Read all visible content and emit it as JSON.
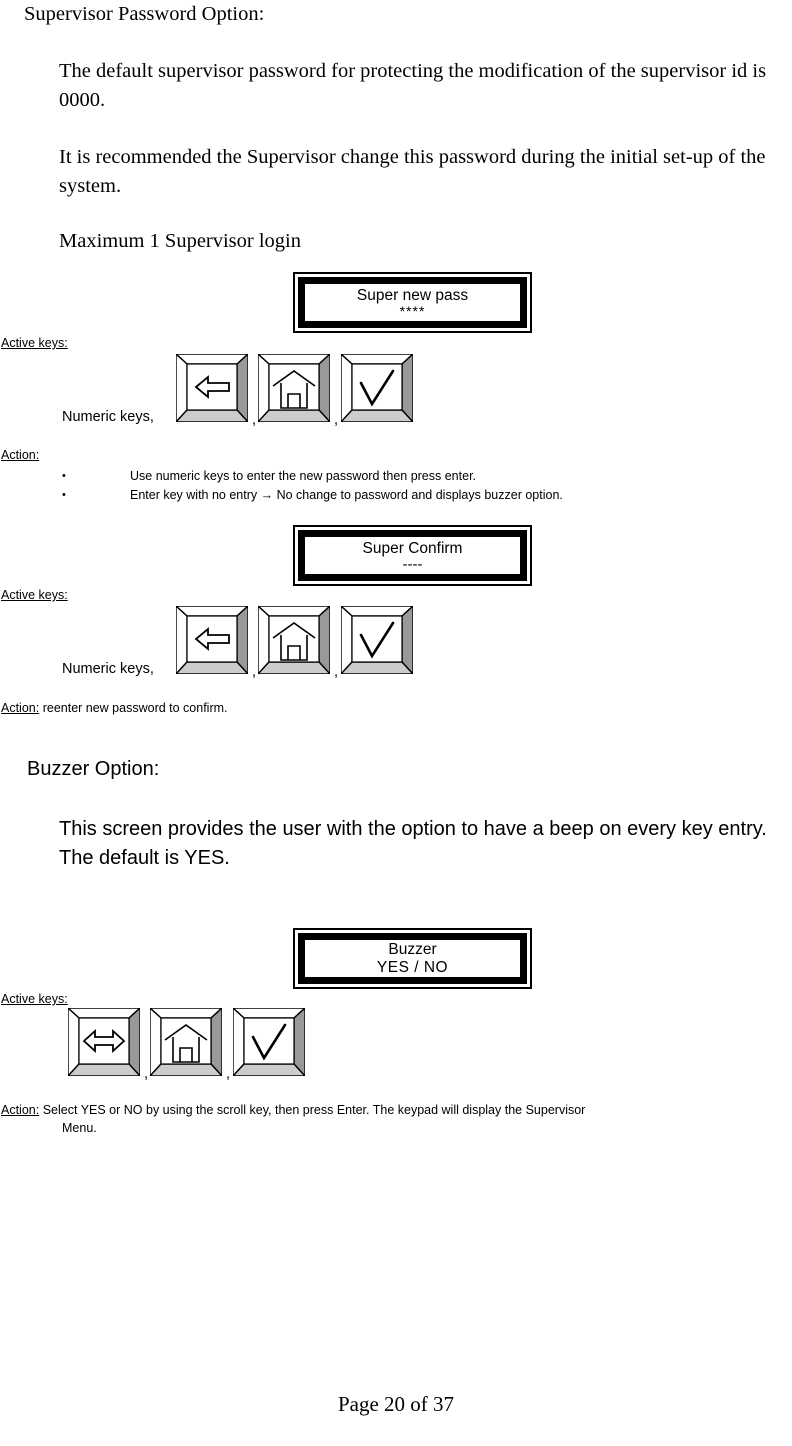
{
  "document": {
    "page_footer": "Page 20 of 37"
  },
  "section_supervisor": {
    "heading": "Supervisor Password Option:",
    "paragraph_1": "The default supervisor password for protecting the modification of the supervisor id is 0000.",
    "paragraph_2": "It is recommended the Supervisor change this password during the initial set-up of the system.",
    "paragraph_3": "Maximum 1 Supervisor login"
  },
  "screen_new_pass": {
    "line1": "Super new pass",
    "line2": "****"
  },
  "active_keys_1": {
    "label": "Active keys:",
    "numeric_label": "Numeric keys,",
    "separator": ",",
    "keys": [
      {
        "name": "back-arrow-key",
        "glyph": "left-arrow-icon"
      },
      {
        "name": "home-key",
        "glyph": "house-icon"
      },
      {
        "name": "enter-key",
        "glyph": "checkmark-icon"
      }
    ]
  },
  "action_1": {
    "label": "Action:",
    "bullets": [
      "Use numeric keys to enter the new password then press enter.",
      "Enter key with no entry → No change to password and displays buzzer option."
    ]
  },
  "screen_confirm": {
    "line1": "Super Confirm",
    "line2": "----"
  },
  "active_keys_2": {
    "label": "Active keys:",
    "numeric_label": "Numeric keys,",
    "separator": ",",
    "keys": [
      {
        "name": "back-arrow-key",
        "glyph": "left-arrow-icon"
      },
      {
        "name": "home-key",
        "glyph": "house-icon"
      },
      {
        "name": "enter-key",
        "glyph": "checkmark-icon"
      }
    ]
  },
  "action_2": {
    "label": "Action:",
    "text": "reenter new password to confirm."
  },
  "section_buzzer": {
    "heading": "Buzzer Option:",
    "paragraph": "This screen provides the user with the option to have a beep on every key entry.  The default is YES."
  },
  "screen_buzzer": {
    "line1": "Buzzer",
    "line2": "YES  /   NO"
  },
  "active_keys_3": {
    "label": "Active keys:",
    "separator": ",",
    "keys": [
      {
        "name": "scroll-key",
        "glyph": "double-arrow-icon"
      },
      {
        "name": "home-key",
        "glyph": "house-icon"
      },
      {
        "name": "enter-key",
        "glyph": "checkmark-icon"
      }
    ]
  },
  "action_3": {
    "label": "Action:",
    "line1": "Select YES or NO by using the scroll key, then press Enter.  The keypad will display the Supervisor",
    "line2": "Menu."
  },
  "colors": {
    "text": "#000000",
    "key_face": "#ffffff",
    "key_bevel_dark": "#999999",
    "key_bevel_light": "#cccccc",
    "frame": "#000000"
  }
}
